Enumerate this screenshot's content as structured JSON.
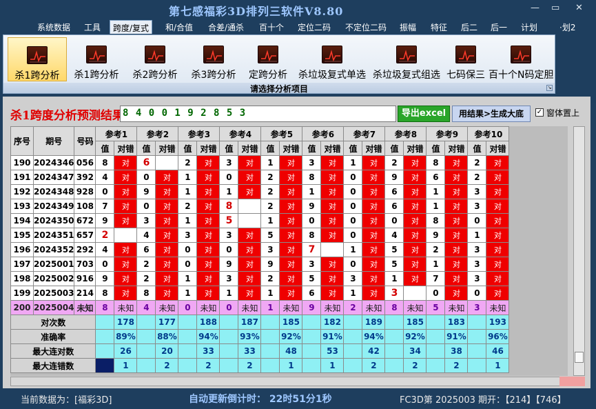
{
  "window": {
    "title": "第七感福彩3D排列三软件V8.80",
    "controls": [
      "—",
      "▭",
      "✕"
    ]
  },
  "menu": [
    "系统数据",
    "工具",
    "跨度/复式",
    "和/合值",
    "合差/通杀",
    "百十个",
    "定位二码",
    "不定位二码",
    "振幅",
    "特征",
    "后二",
    "后一",
    "计划",
    "·划2"
  ],
  "ribbon": {
    "buttons": [
      "杀1跨分析",
      "杀1跨分析",
      "杀2跨分析",
      "杀3跨分析",
      "定跨分析",
      "杀垃圾复式单选",
      "杀垃圾复式组选",
      "七码保三",
      "百十个N码定胆"
    ],
    "caption": "请选择分析项目"
  },
  "header": {
    "title": "杀1跨度分析预测结果",
    "prediction": "8 4 0 0 1 9 2 8 5 3",
    "export_label": "导出excel",
    "generate_label": "用结果>生成大底",
    "pin_label": "窗体置上",
    "pin_checked": "✓"
  },
  "grid": {
    "headers": {
      "seq": "序号",
      "period": "期号",
      "code": "号码",
      "value": "值",
      "check": "对错",
      "ok": "对",
      "refs": [
        "参考1",
        "参考2",
        "参考3",
        "参考4",
        "参考5",
        "参考6",
        "参考7",
        "参考8",
        "参考9",
        "参考10"
      ]
    },
    "rows": [
      {
        "seq": "190",
        "period": "2024346",
        "code": "056",
        "refs": [
          [
            "8",
            true
          ],
          [
            "6",
            false
          ],
          [
            "2",
            true
          ],
          [
            "3",
            true
          ],
          [
            "1",
            true
          ],
          [
            "3",
            true
          ],
          [
            "1",
            true
          ],
          [
            "2",
            true
          ],
          [
            "8",
            true
          ],
          [
            "2",
            true
          ]
        ]
      },
      {
        "seq": "191",
        "period": "2024347",
        "code": "392",
        "refs": [
          [
            "4",
            true
          ],
          [
            "0",
            true
          ],
          [
            "1",
            true
          ],
          [
            "0",
            true
          ],
          [
            "2",
            true
          ],
          [
            "8",
            true
          ],
          [
            "0",
            true
          ],
          [
            "9",
            true
          ],
          [
            "6",
            true
          ],
          [
            "2",
            true
          ]
        ]
      },
      {
        "seq": "192",
        "period": "2024348",
        "code": "928",
        "refs": [
          [
            "0",
            true
          ],
          [
            "9",
            true
          ],
          [
            "1",
            true
          ],
          [
            "1",
            true
          ],
          [
            "2",
            true
          ],
          [
            "1",
            true
          ],
          [
            "0",
            true
          ],
          [
            "6",
            true
          ],
          [
            "1",
            true
          ],
          [
            "3",
            true
          ]
        ]
      },
      {
        "seq": "193",
        "period": "2024349",
        "code": "108",
        "refs": [
          [
            "7",
            true
          ],
          [
            "0",
            true
          ],
          [
            "2",
            true
          ],
          [
            "8",
            false
          ],
          [
            "2",
            true
          ],
          [
            "9",
            true
          ],
          [
            "0",
            true
          ],
          [
            "6",
            true
          ],
          [
            "1",
            true
          ],
          [
            "3",
            true
          ]
        ]
      },
      {
        "seq": "194",
        "period": "2024350",
        "code": "672",
        "refs": [
          [
            "9",
            true
          ],
          [
            "3",
            true
          ],
          [
            "1",
            true
          ],
          [
            "5",
            false
          ],
          [
            "1",
            true
          ],
          [
            "0",
            true
          ],
          [
            "0",
            true
          ],
          [
            "0",
            true
          ],
          [
            "8",
            true
          ],
          [
            "0",
            true
          ]
        ]
      },
      {
        "seq": "195",
        "period": "2024351",
        "code": "657",
        "refs": [
          [
            "2",
            false
          ],
          [
            "4",
            true
          ],
          [
            "3",
            true
          ],
          [
            "3",
            true
          ],
          [
            "5",
            true
          ],
          [
            "8",
            true
          ],
          [
            "0",
            true
          ],
          [
            "4",
            true
          ],
          [
            "9",
            true
          ],
          [
            "1",
            true
          ]
        ]
      },
      {
        "seq": "196",
        "period": "2024352",
        "code": "292",
        "refs": [
          [
            "4",
            true
          ],
          [
            "6",
            true
          ],
          [
            "0",
            true
          ],
          [
            "0",
            true
          ],
          [
            "3",
            true
          ],
          [
            "7",
            false
          ],
          [
            "1",
            true
          ],
          [
            "5",
            true
          ],
          [
            "2",
            true
          ],
          [
            "3",
            true
          ]
        ]
      },
      {
        "seq": "197",
        "period": "2025001",
        "code": "703",
        "refs": [
          [
            "0",
            true
          ],
          [
            "2",
            true
          ],
          [
            "0",
            true
          ],
          [
            "9",
            true
          ],
          [
            "9",
            true
          ],
          [
            "3",
            true
          ],
          [
            "0",
            true
          ],
          [
            "5",
            true
          ],
          [
            "1",
            true
          ],
          [
            "3",
            true
          ]
        ]
      },
      {
        "seq": "198",
        "period": "2025002",
        "code": "916",
        "refs": [
          [
            "9",
            true
          ],
          [
            "2",
            true
          ],
          [
            "1",
            true
          ],
          [
            "3",
            true
          ],
          [
            "2",
            true
          ],
          [
            "5",
            true
          ],
          [
            "3",
            true
          ],
          [
            "1",
            true
          ],
          [
            "7",
            true
          ],
          [
            "3",
            true
          ]
        ]
      },
      {
        "seq": "199",
        "period": "2025003",
        "code": "214",
        "refs": [
          [
            "8",
            true
          ],
          [
            "8",
            true
          ],
          [
            "1",
            true
          ],
          [
            "1",
            true
          ],
          [
            "1",
            true
          ],
          [
            "6",
            true
          ],
          [
            "1",
            true
          ],
          [
            "3",
            false
          ],
          [
            "0",
            true
          ],
          [
            "0",
            true
          ]
        ]
      }
    ],
    "pending": {
      "seq": "200",
      "period": "2025004",
      "code": "未知",
      "unknown": "未知",
      "values": [
        "8",
        "4",
        "0",
        "0",
        "1",
        "9",
        "2",
        "8",
        "5",
        "3"
      ]
    },
    "stats": [
      {
        "label": "对次数",
        "values": [
          "178",
          "177",
          "188",
          "187",
          "185",
          "182",
          "189",
          "185",
          "183",
          "193"
        ]
      },
      {
        "label": "准确率",
        "values": [
          "89%",
          "88%",
          "94%",
          "93%",
          "92%",
          "91%",
          "94%",
          "92%",
          "91%",
          "96%"
        ]
      },
      {
        "label": "最大连对数",
        "values": [
          "26",
          "20",
          "33",
          "33",
          "48",
          "53",
          "42",
          "34",
          "38",
          "46"
        ]
      },
      {
        "label": "最大连错数",
        "values": [
          "1",
          "2",
          "2",
          "2",
          "1",
          "1",
          "2",
          "2",
          "2",
          "1"
        ]
      }
    ]
  },
  "status": {
    "current_data": "当前数据为：[福彩3D]",
    "countdown": "自动更新倒计时：  22时51分1秒",
    "draw_info": "FC3D第 2025003 期开：【214】【746】"
  },
  "colors": {
    "accent_red": "#ef0000",
    "stat_cyan": "#8ff0f4",
    "pending_pink": "#f0a8f4",
    "window_navy": "#1e3e5e"
  }
}
